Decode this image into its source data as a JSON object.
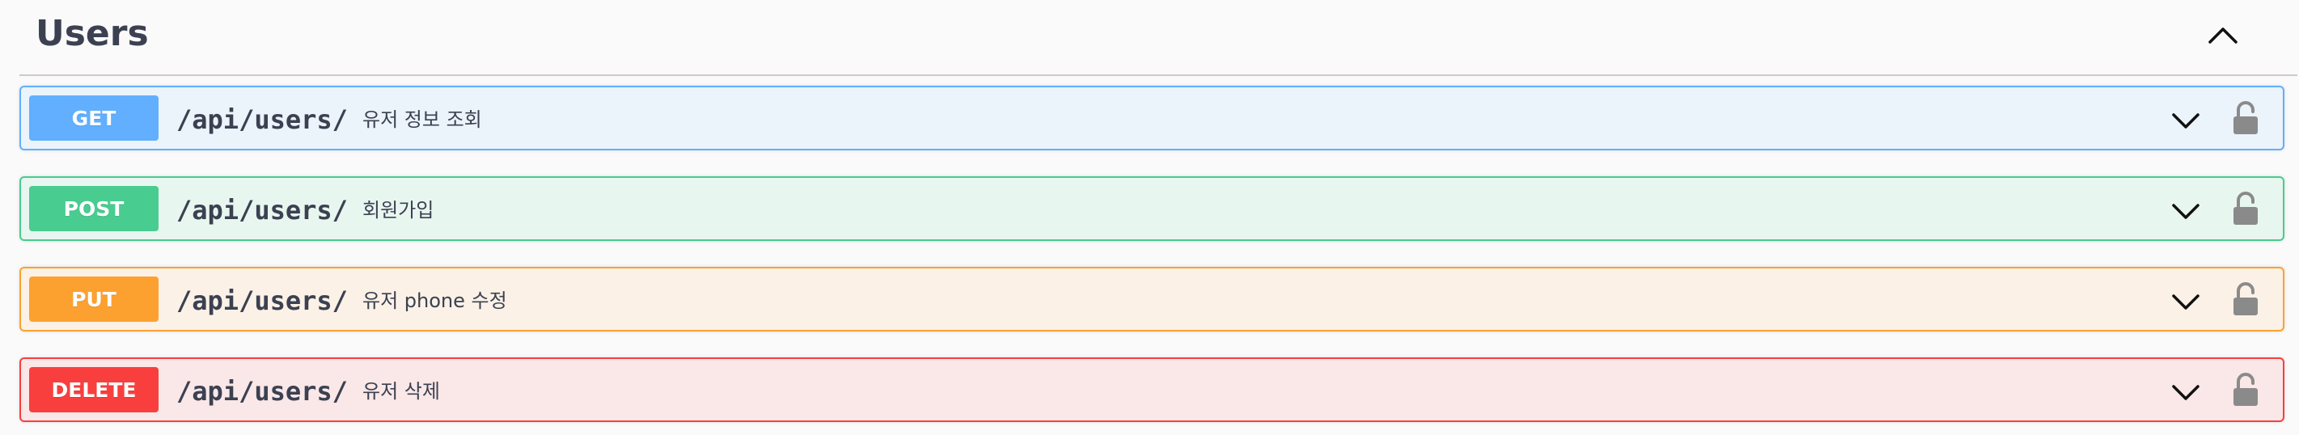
{
  "tag": {
    "title": "Users",
    "toggle_icon": "chevron-up-icon"
  },
  "operations": [
    {
      "method": "GET",
      "path": "/api/users/",
      "summary": "유저 정보 조회",
      "color": "#61affe"
    },
    {
      "method": "POST",
      "path": "/api/users/",
      "summary": "회원가입",
      "color": "#49cc90"
    },
    {
      "method": "PUT",
      "path": "/api/users/",
      "summary": "유저 phone 수정",
      "color": "#fca130"
    },
    {
      "method": "DELETE",
      "path": "/api/users/",
      "summary": "유저 삭제",
      "color": "#f93e3e"
    }
  ],
  "icons": {
    "expand": "chevron-down-icon",
    "authorize": "lock-icon"
  }
}
